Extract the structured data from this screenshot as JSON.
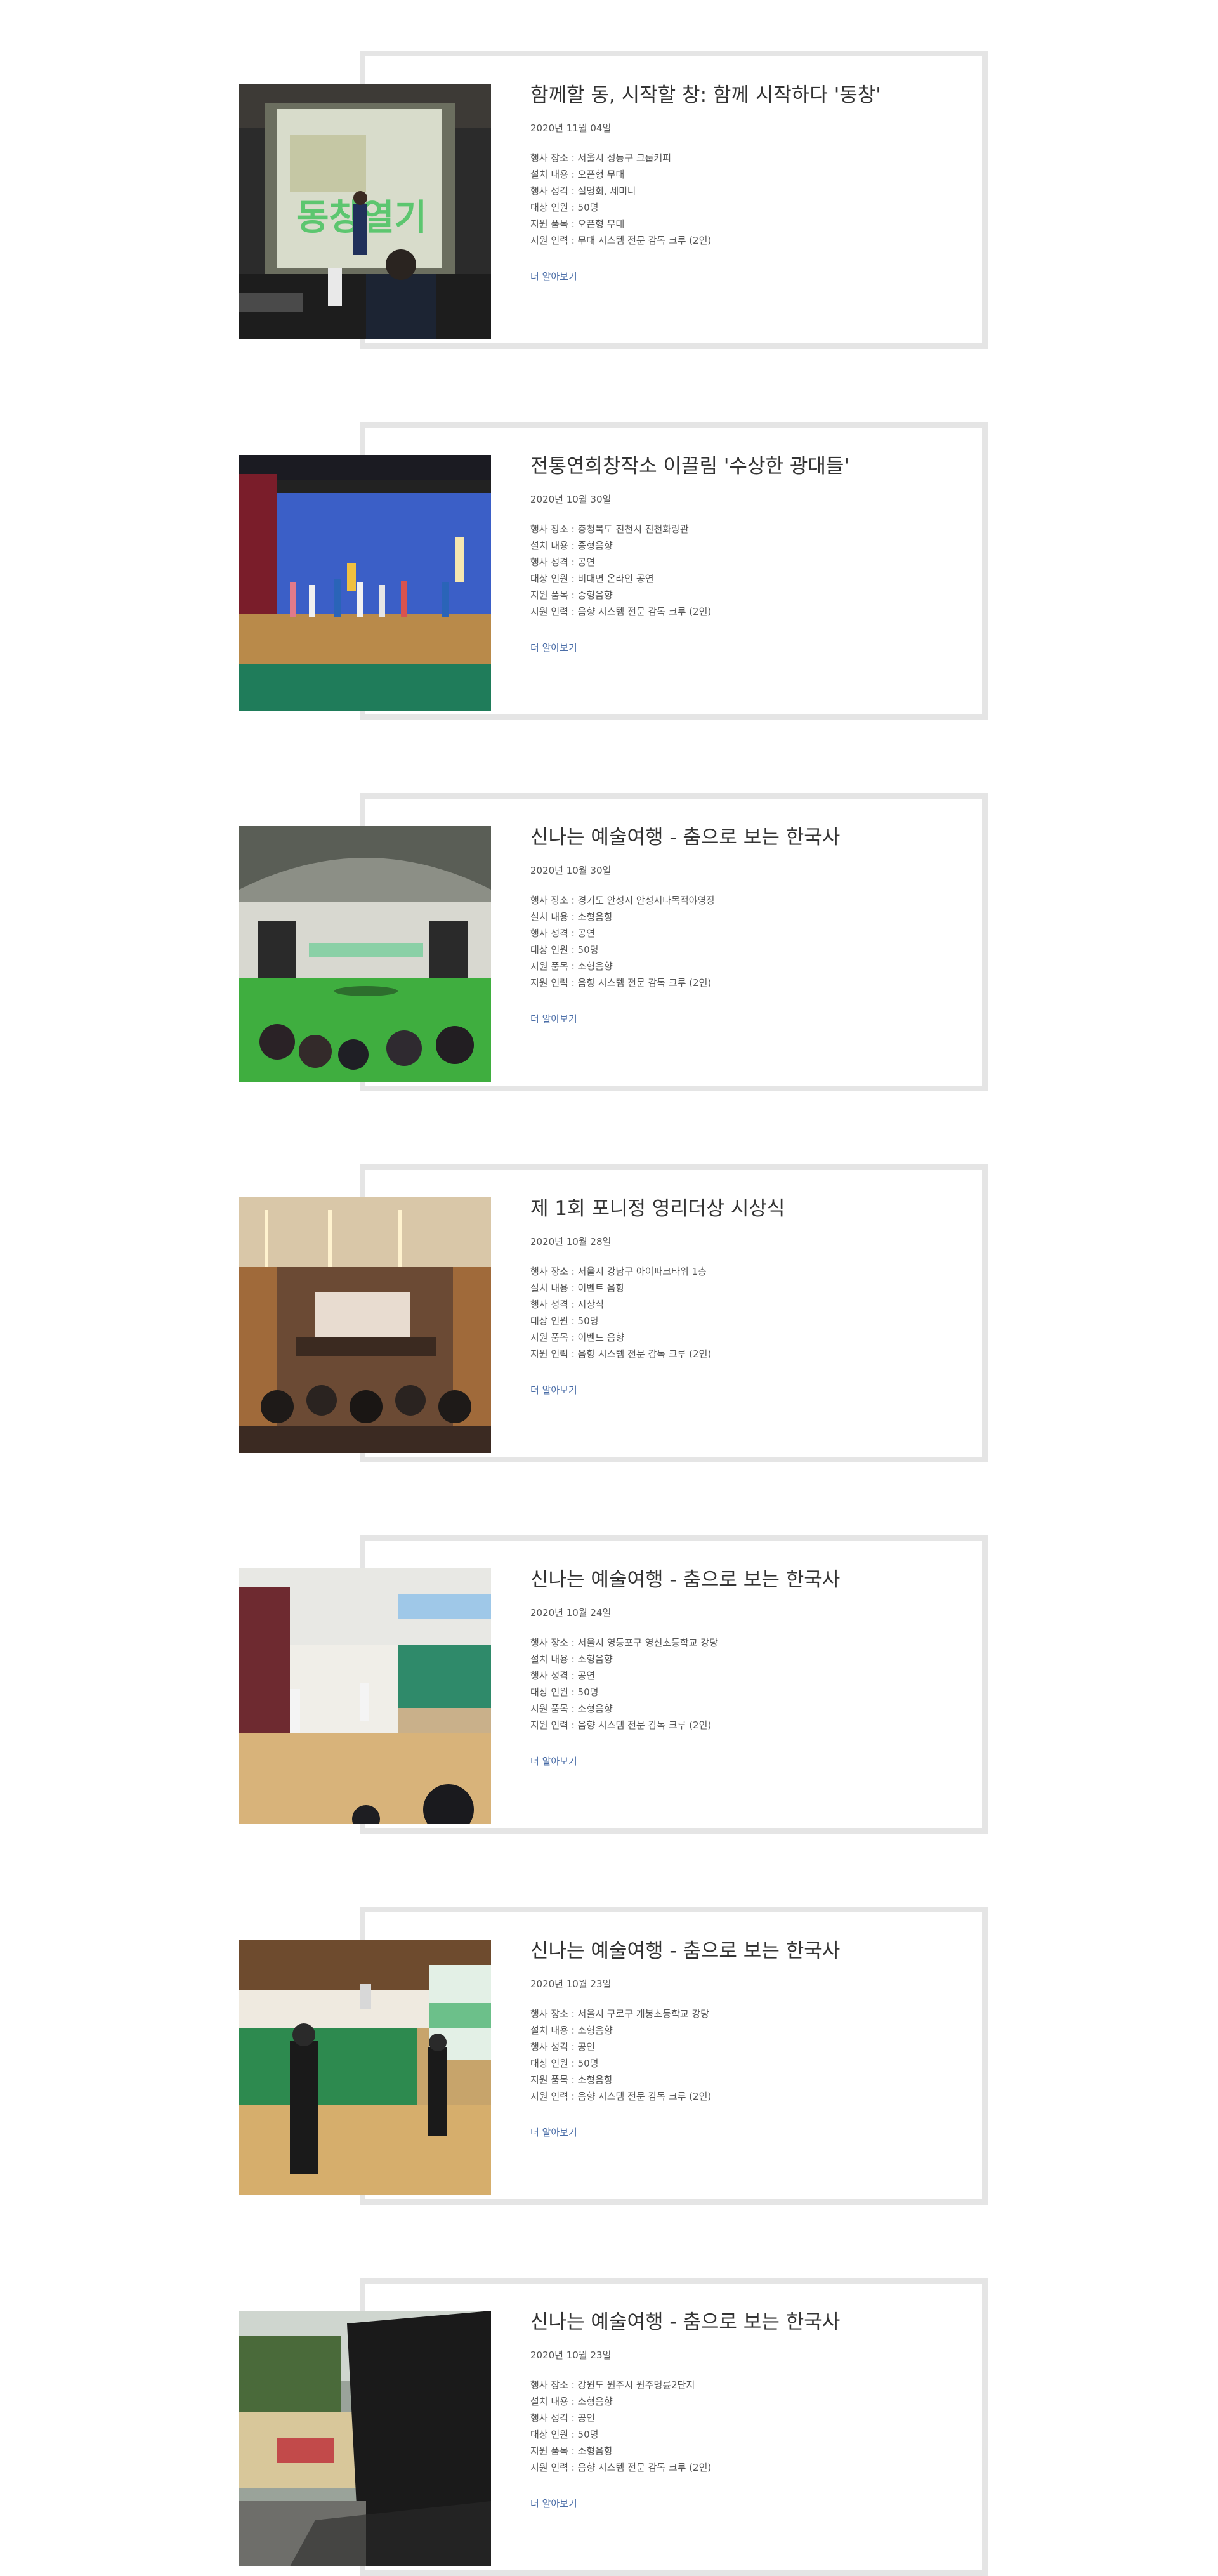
{
  "posts": [
    {
      "title": "함께할 동, 시작할 창: 함께 시작하다 '동창'",
      "date": "2020년 11월 04일",
      "details": [
        "행사 장소 : 서울시 성동구 크룹커피",
        "설치 내용 : 오픈형 무대",
        "행사 성격 : 설명회, 세미나",
        "대상 인원 : 50명",
        "지원 품목 : 오픈형 무대",
        "지원 인력 : 무대 시스템 전문 감독 크루 (2인)"
      ],
      "more_label": "더 알아보기",
      "photo_text": "동창열기"
    },
    {
      "title": "전통연희창작소 이끌림 '수상한 광대들'",
      "date": "2020년 10월 30일",
      "details": [
        "행사 장소 : 충청북도 진천시 진천화랑관",
        "설치 내용 : 중형음향",
        "행사 성격 : 공연",
        "대상 인원 : 비대면 온라인 공연",
        "지원 품목 : 중형음향",
        "지원 인력 : 음향 시스템 전문 감독 크루 (2인)"
      ],
      "more_label": "더 알아보기"
    },
    {
      "title": "신나는 예술여행 - 춤으로 보는 한국사",
      "date": "2020년 10월 30일",
      "details": [
        "행사 장소 : 경기도 안성시 안성시다목적야영장",
        "설치 내용 : 소형음향",
        "행사 성격 : 공연",
        "대상 인원 : 50명",
        "지원 품목 : 소형음향",
        "지원 인력 : 음향 시스템 전문 감독 크루 (2인)"
      ],
      "more_label": "더 알아보기"
    },
    {
      "title": "제 1회 포니정 영리더상 시상식",
      "date": "2020년 10월 28일",
      "details": [
        "행사 장소 : 서울시 강남구 아이파크타워 1층",
        "설치 내용 : 이벤트 음향",
        "행사 성격 : 시상식",
        "대상 인원 : 50명",
        "지원 품목 : 이벤트 음향",
        "지원 인력 : 음향 시스템 전문 감독 크루 (2인)"
      ],
      "more_label": "더 알아보기"
    },
    {
      "title": "신나는 예술여행 - 춤으로 보는 한국사",
      "date": "2020년 10월 24일",
      "details": [
        "행사 장소 : 서울시 영등포구 영신초등학교 강당",
        "설치 내용 : 소형음향",
        "행사 성격 : 공연",
        "대상 인원 : 50명",
        "지원 품목 : 소형음향",
        "지원 인력 : 음향 시스템 전문 감독 크루 (2인)"
      ],
      "more_label": "더 알아보기"
    },
    {
      "title": "신나는 예술여행 - 춤으로 보는 한국사",
      "date": "2020년 10월 23일",
      "details": [
        "행사 장소 : 서울시 구로구 개봉초등학교 강당",
        "설치 내용 : 소형음향",
        "행사 성격 : 공연",
        "대상 인원 : 50명",
        "지원 품목 : 소형음향",
        "지원 인력 : 음향 시스템 전문 감독 크루 (2인)"
      ],
      "more_label": "더 알아보기"
    },
    {
      "title": "신나는 예술여행 - 춤으로 보는 한국사",
      "date": "2020년 10월 23일",
      "details": [
        "행사 장소 : 강원도 원주시 원주명륜2단지",
        "설치 내용 : 소형음향",
        "행사 성격 : 공연",
        "대상 인원 : 50명",
        "지원 품목 : 소형음향",
        "지원 인력 : 음향 시스템 전문 감독 크루 (2인)"
      ],
      "more_label": "더 알아보기"
    }
  ]
}
